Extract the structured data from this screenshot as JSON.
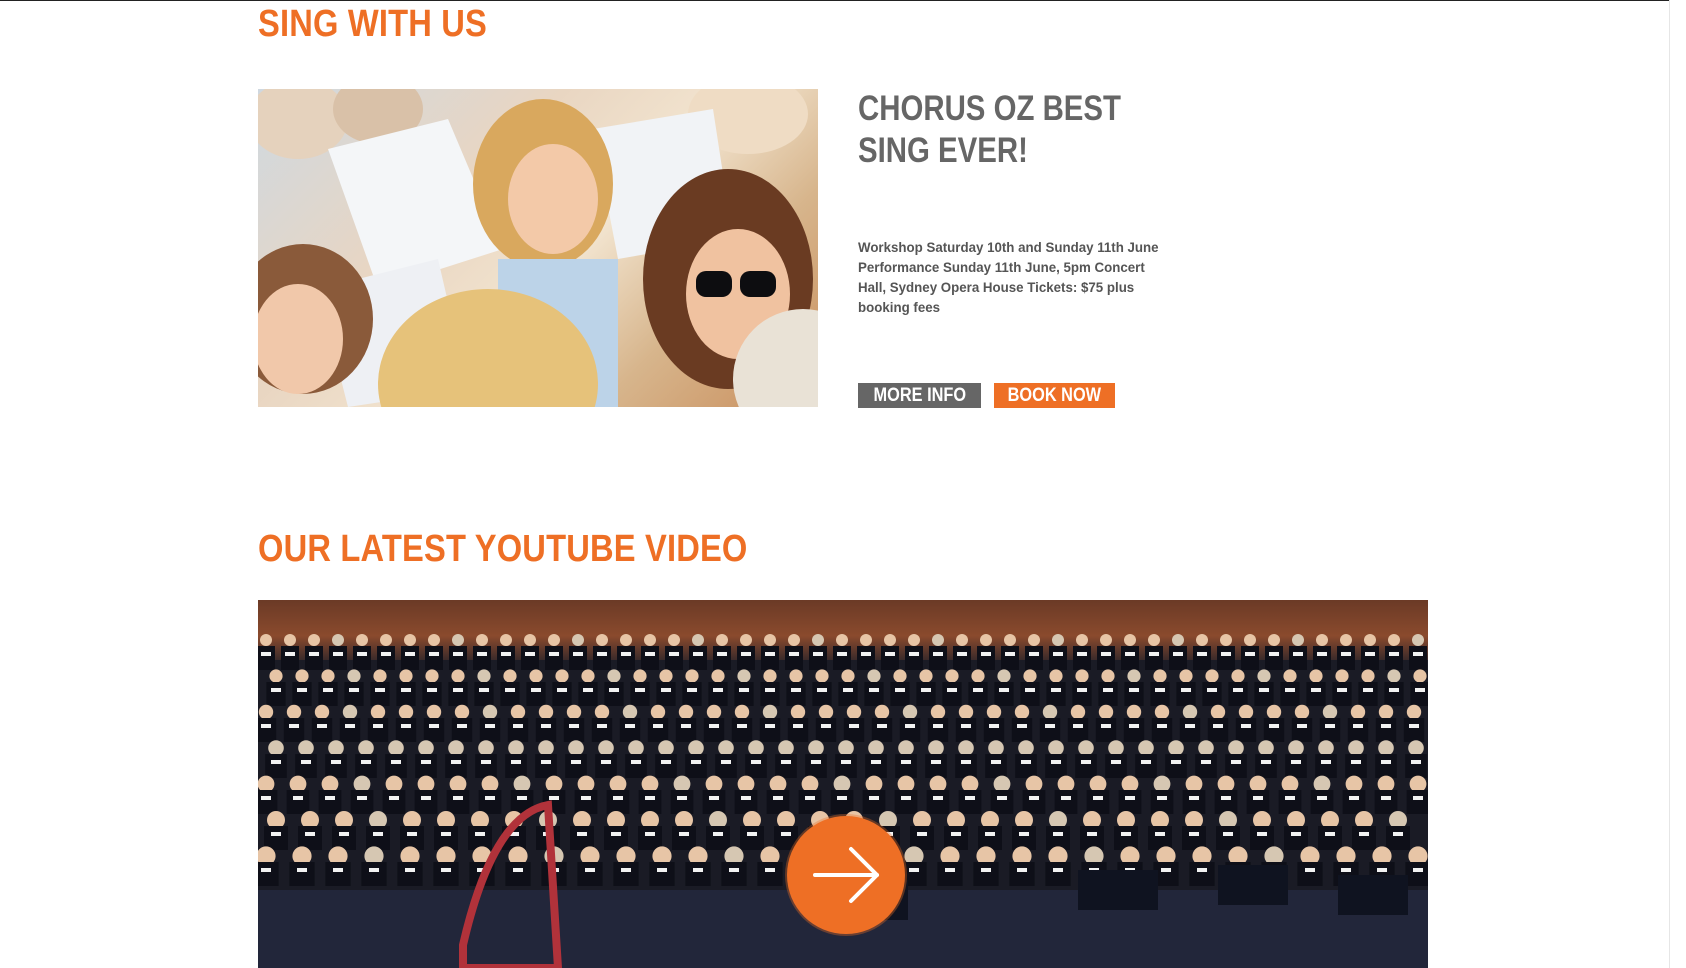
{
  "sections": {
    "sing_with_us": {
      "heading": "SING WITH US",
      "event": {
        "title": "CHORUS OZ BEST SING EVER!",
        "details": "Workshop Saturday 10th and Sunday 11th June Performance Sunday 11th June, 5pm Concert Hall, Sydney Opera House Tickets: $75 plus booking fees",
        "more_info_label": "MORE INFO",
        "book_now_label": "BOOK NOW"
      }
    },
    "youtube": {
      "heading": "OUR LATEST YOUTUBE VIDEO",
      "play_icon": "arrow-right-icon"
    }
  },
  "colors": {
    "accent": "#ee6f25",
    "grey_button": "#666666",
    "title_grey": "#666666",
    "text_grey": "#555555"
  }
}
